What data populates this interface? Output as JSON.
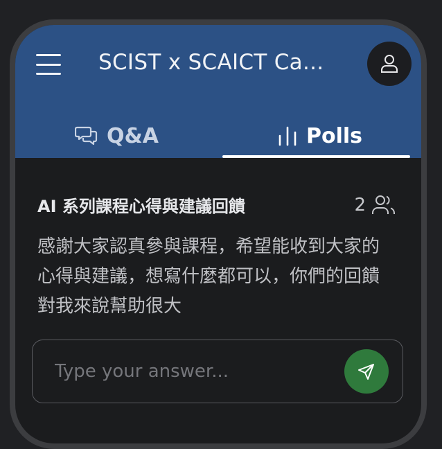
{
  "header": {
    "title": "SCIST x SCAICT Ca..."
  },
  "tabs": [
    {
      "label": "Q&A",
      "icon": "chat-bubbles-icon",
      "active": false
    },
    {
      "label": "Polls",
      "icon": "bar-chart-icon",
      "active": true
    }
  ],
  "poll": {
    "title": "AI 系列課程心得與建議回饋",
    "participant_count": "2",
    "description": "感謝大家認真參與課程，希望能收到大家的心得與建議，想寫什麼都可以，你們的回饋對我來說幫助很大"
  },
  "answer": {
    "placeholder": "Type your answer..."
  },
  "colors": {
    "header_bg": "#2c5185",
    "send_button": "#2f7a3c",
    "background": "#1b1c1e"
  }
}
